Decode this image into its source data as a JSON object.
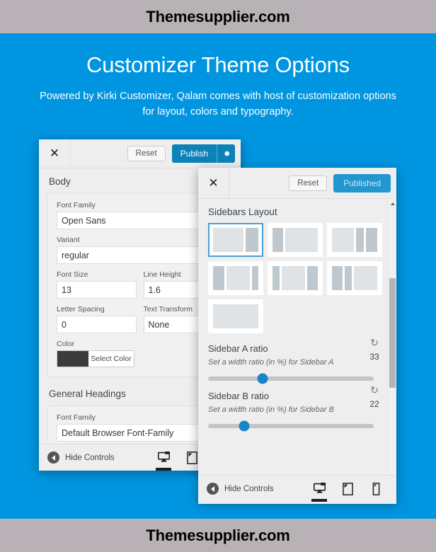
{
  "branding": {
    "top": "Themesupplier.com",
    "bottom": "Themesupplier.com"
  },
  "hero": {
    "title": "Customizer Theme Options",
    "subtitle": "Powered by Kirki Customizer, Qalam comes with host of customization options for layout, colors and typography.",
    "background_color": "#0095e0"
  },
  "left_panel": {
    "close_icon": "close-icon",
    "reset_label": "Reset",
    "publish_label": "Publish",
    "publish_gear_icon": "gear-icon",
    "accent_color": "#0b82b8",
    "sections": [
      {
        "title": "Body",
        "fields": [
          {
            "label": "Font Family",
            "value": "Open Sans"
          },
          {
            "label": "Variant",
            "value": "regular"
          },
          {
            "label": "Font Size",
            "value": "13"
          },
          {
            "label": "Line Height",
            "value": "1.6"
          },
          {
            "label": "Letter Spacing",
            "value": "0"
          },
          {
            "label": "Text Transform",
            "value": "None"
          }
        ],
        "color": {
          "label": "Color",
          "button_label": "Select Color",
          "swatch": "#3b3b3b"
        }
      },
      {
        "title": "General Headings",
        "fields": [
          {
            "label": "Font Family",
            "value": "Default Browser Font-Family"
          }
        ]
      }
    ],
    "footer": {
      "hide_controls_label": "Hide Controls",
      "devices": [
        {
          "name": "desktop",
          "active": true
        },
        {
          "name": "tablet",
          "active": false
        },
        {
          "name": "mobile",
          "active": false
        }
      ]
    }
  },
  "right_panel": {
    "close_icon": "close-icon",
    "reset_label": "Reset",
    "publish_label": "Published",
    "published_color": "#2196cf",
    "title": "Sidebars Layout",
    "layouts": [
      {
        "id": "content-right-sidebar",
        "selected": true,
        "blocks": [
          {
            "flex": 68,
            "shade": "light"
          },
          {
            "flex": 28,
            "shade": "dark"
          }
        ]
      },
      {
        "id": "left-sidebar-content",
        "selected": false,
        "blocks": [
          {
            "flex": 24,
            "shade": "dark"
          },
          {
            "flex": 72,
            "shade": "light"
          }
        ]
      },
      {
        "id": "content-two-right-sidebars",
        "selected": false,
        "blocks": [
          {
            "flex": 50,
            "shade": "light"
          },
          {
            "flex": 18,
            "shade": "dark"
          },
          {
            "flex": 26,
            "shade": "dark"
          }
        ]
      },
      {
        "id": "sidebar-content-thin-sidebar",
        "selected": false,
        "blocks": [
          {
            "flex": 26,
            "shade": "dark"
          },
          {
            "flex": 52,
            "shade": "light"
          },
          {
            "flex": 14,
            "shade": "dark"
          }
        ]
      },
      {
        "id": "thin-sidebar-content-sidebar",
        "selected": false,
        "blocks": [
          {
            "flex": 16,
            "shade": "dark"
          },
          {
            "flex": 54,
            "shade": "light"
          },
          {
            "flex": 24,
            "shade": "dark"
          }
        ]
      },
      {
        "id": "two-left-sidebars-content",
        "selected": false,
        "blocks": [
          {
            "flex": 24,
            "shade": "dark"
          },
          {
            "flex": 16,
            "shade": "dark"
          },
          {
            "flex": 54,
            "shade": "light"
          }
        ]
      },
      {
        "id": "full-width-no-sidebar",
        "selected": false,
        "blocks": [
          {
            "flex": 100,
            "shade": "light"
          }
        ]
      }
    ],
    "sliders": [
      {
        "title": "Sidebar A ratio",
        "description": "Set a width ratio (in %) for Sidebar A",
        "value": "33",
        "percent": 33,
        "reset_icon": "reset-circular-arrow-icon"
      },
      {
        "title": "Sidebar B ratio",
        "description": "Set a width ratio (in %) for Sidebar B",
        "value": "22",
        "percent": 22,
        "reset_icon": "reset-circular-arrow-icon"
      }
    ],
    "footer": {
      "hide_controls_label": "Hide Controls",
      "devices": [
        {
          "name": "desktop",
          "active": true
        },
        {
          "name": "tablet",
          "active": false
        },
        {
          "name": "mobile",
          "active": false
        }
      ]
    },
    "scrollbar": {
      "thumb_top_percent": 26,
      "thumb_height_percent": 36
    }
  }
}
